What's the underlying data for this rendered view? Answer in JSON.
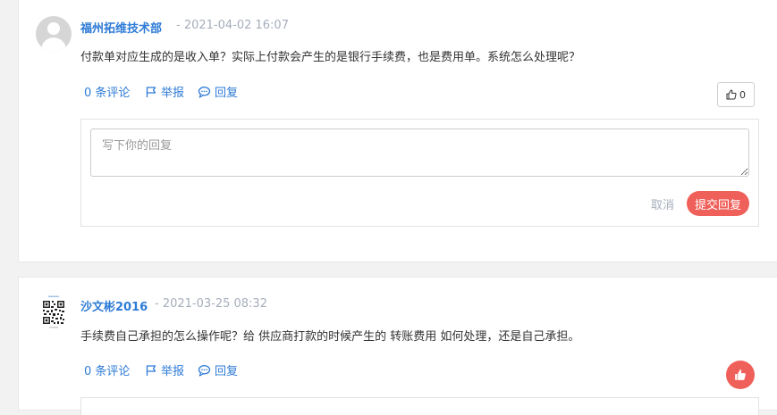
{
  "comments": [
    {
      "username": "福州拓维技术部",
      "timestamp": "- 2021-04-02 16:07",
      "content": "付款单对应生成的是收入单？实际上付款会产生的是银行手续费，也是费用单。系统怎么处理呢？",
      "actions": {
        "comments": "0 条评论",
        "report": "举报",
        "reply": "回复"
      },
      "like_count": "0",
      "reply_box": {
        "placeholder": "写下你的回复",
        "cancel_label": "取消",
        "submit_label": "提交回复"
      }
    },
    {
      "username": "沙文彬2016",
      "timestamp": "- 2021-03-25 08:32",
      "content": "手续费自己承担的怎么操作呢？给 供应商打款的时候产生的 转账费用 如何处理，还是自己承担。",
      "actions": {
        "comments": "0 条评论",
        "report": "举报",
        "reply": "回复"
      }
    }
  ],
  "colors": {
    "link": "#2e7bd6",
    "muted": "#a6aebb",
    "accent": "#f0605a"
  },
  "icons": {
    "default_avatar": "user-avatar-icon",
    "qr_avatar": "qr-code-avatar",
    "report": "flag-icon",
    "reply": "speech-bubble-icon",
    "like": "thumbs-up-icon"
  }
}
